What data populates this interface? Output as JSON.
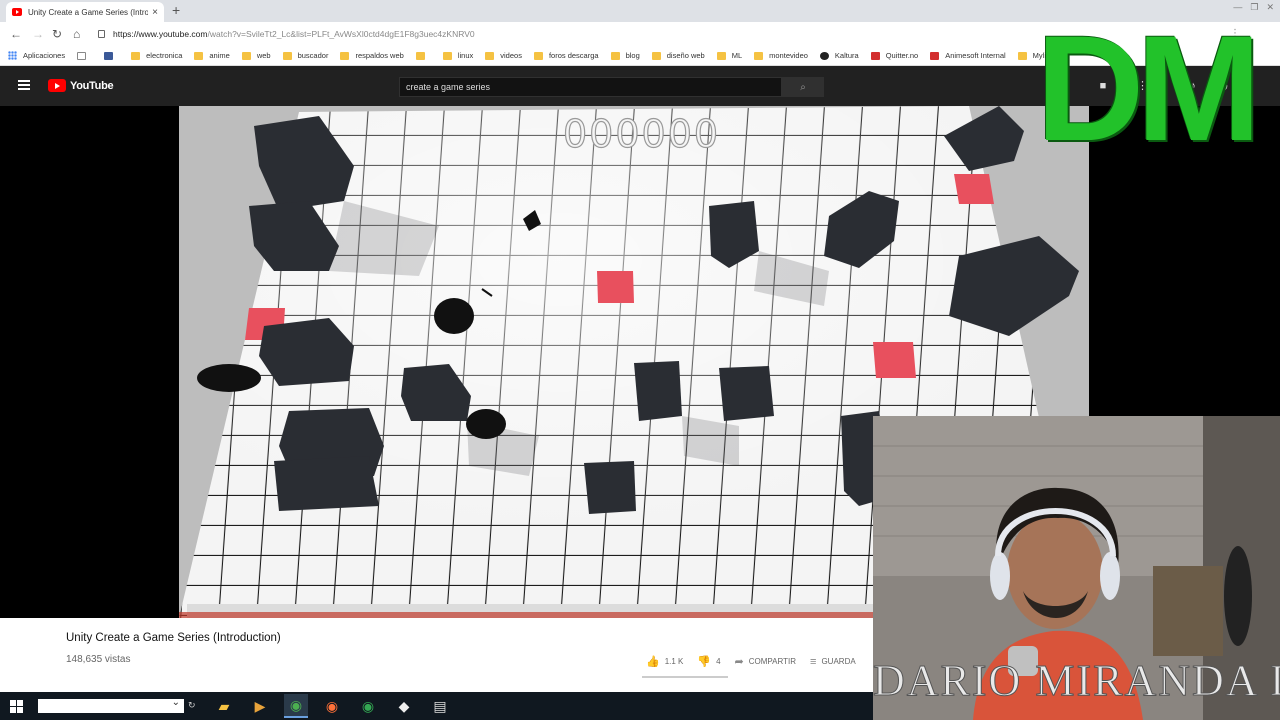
{
  "browser": {
    "tab_title": "Unity Create a Game Series (Intro",
    "url_host": "https://www.youtube.com",
    "url_path": "/watch?v=SvileTt2_Lc&list=PLFt_AvWsXl0ctd4dgE1F8g3uec4zKNRV0",
    "bookmarks": [
      "Aplicaciones",
      "",
      "",
      "electronica",
      "anime",
      "web",
      "buscador",
      "respaldos web",
      "",
      "linux",
      "videos",
      "foros descarga",
      "blog",
      "diseño web",
      "ML",
      "montevideo",
      "Kaltura",
      "Quitter.no",
      "Animesoft Internal",
      "Mylin.net"
    ]
  },
  "youtube": {
    "logo_text": "YouTube",
    "search_value": "create a game series"
  },
  "watermark": {
    "corner_text": "DM",
    "cam_text": "DARIO MIRANDA D"
  },
  "video": {
    "score": "000000",
    "title": "Unity Create a Game Series (Introduction)",
    "views": "148,635 vistas",
    "likes": "1.1 K",
    "dislikes": "4",
    "share_label": "COMPARTIR",
    "save_label": "GUARDA"
  },
  "colors": {
    "yt_header": "#212121",
    "yt_red": "#ff0000",
    "dm_green": "#22c22a",
    "floor_red": "#e8505e"
  }
}
